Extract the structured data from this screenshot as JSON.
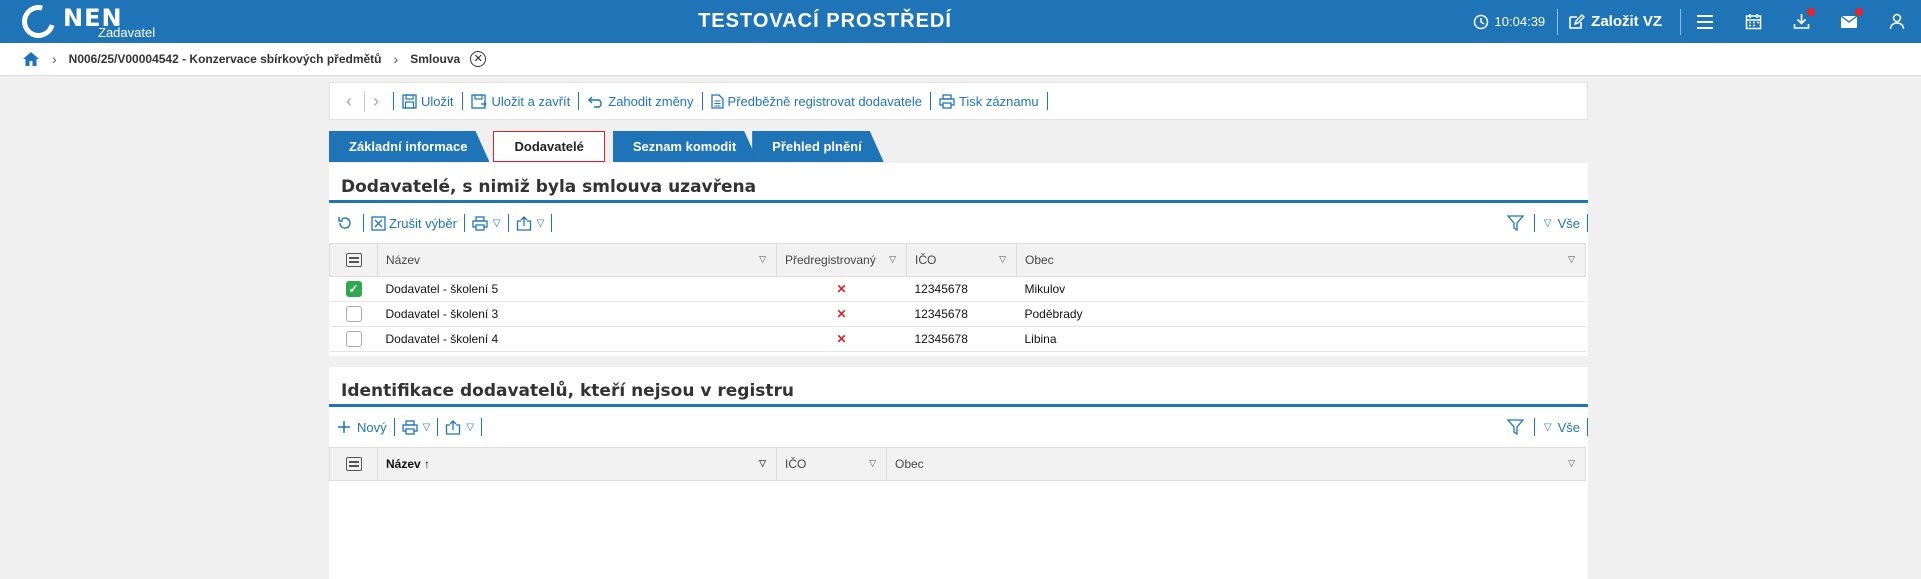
{
  "header": {
    "logo_text": "NEN",
    "logo_sub": "Zadavatel",
    "environment_title": "TESTOVACÍ PROSTŘEDÍ",
    "clock": "10:04:39",
    "create_label": "Založit VZ",
    "icons": [
      "menu-icon",
      "calendar-icon",
      "download-icon",
      "mail-icon",
      "user-icon"
    ],
    "accent_color": "#1f73b7",
    "badge_color": "#e0252b"
  },
  "breadcrumb": {
    "items": [
      {
        "label": "N006/25/V00004542 - Konzervace sbírkových předmětů"
      },
      {
        "label": "Smlouva"
      }
    ]
  },
  "toolbar": {
    "save": "Uložit",
    "save_close": "Uložit a zavřít",
    "discard": "Zahodit změny",
    "preregister": "Předběžně registrovat dodavatele",
    "print": "Tisk záznamu"
  },
  "tabs": [
    {
      "label": "Základní informace",
      "active": false
    },
    {
      "label": "Dodavatelé",
      "active": true
    },
    {
      "label": "Seznam komodit",
      "active": false
    },
    {
      "label": "Přehled plnění",
      "active": false
    }
  ],
  "panel1": {
    "title": "Dodavatelé, s nimiž byla smlouva uzavřena",
    "clear_selection": "Zrušit výběr",
    "all_label": "Vše",
    "columns": [
      "Název",
      "Předregistrovaný",
      "IČO",
      "Obec"
    ],
    "rows": [
      {
        "checked": true,
        "name": "Dodavatel - školení 5",
        "preregistered": "✕",
        "ico": "12345678",
        "city": "Mikulov"
      },
      {
        "checked": false,
        "name": "Dodavatel - školení 3",
        "preregistered": "✕",
        "ico": "12345678",
        "city": "Poděbrady"
      },
      {
        "checked": false,
        "name": "Dodavatel - školení 4",
        "preregistered": "✕",
        "ico": "12345678",
        "city": "Libina"
      }
    ]
  },
  "panel2": {
    "title": "Identifikace dodavatelů, kteří nejsou v registru",
    "new_label": "Nový",
    "all_label": "Vše",
    "columns": [
      "Název",
      "IČO",
      "Obec"
    ]
  }
}
